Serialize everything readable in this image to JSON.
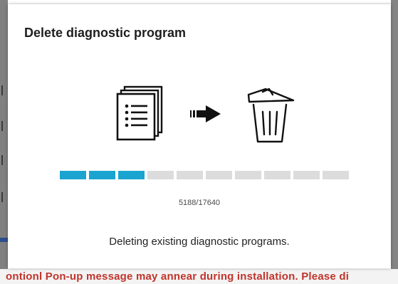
{
  "dialog": {
    "title": "Delete diagnostic program",
    "progress": {
      "completed": 5188,
      "total": 17640,
      "filled_segments": 3,
      "total_segments": 10,
      "counter_text": "5188/17640"
    },
    "status_text": "Deleting existing diagnostic programs.",
    "icons": {
      "source": "document-list-icon",
      "arrow": "arrow-right-icon",
      "target": "trash-can-icon"
    }
  },
  "background": {
    "notice_text": "ontionl Pon-up message may annear during installation. Please di"
  },
  "colors": {
    "progress_filled": "#1ba4d0",
    "progress_empty": "#dcdcdc",
    "notice_text": "#c0342b"
  }
}
